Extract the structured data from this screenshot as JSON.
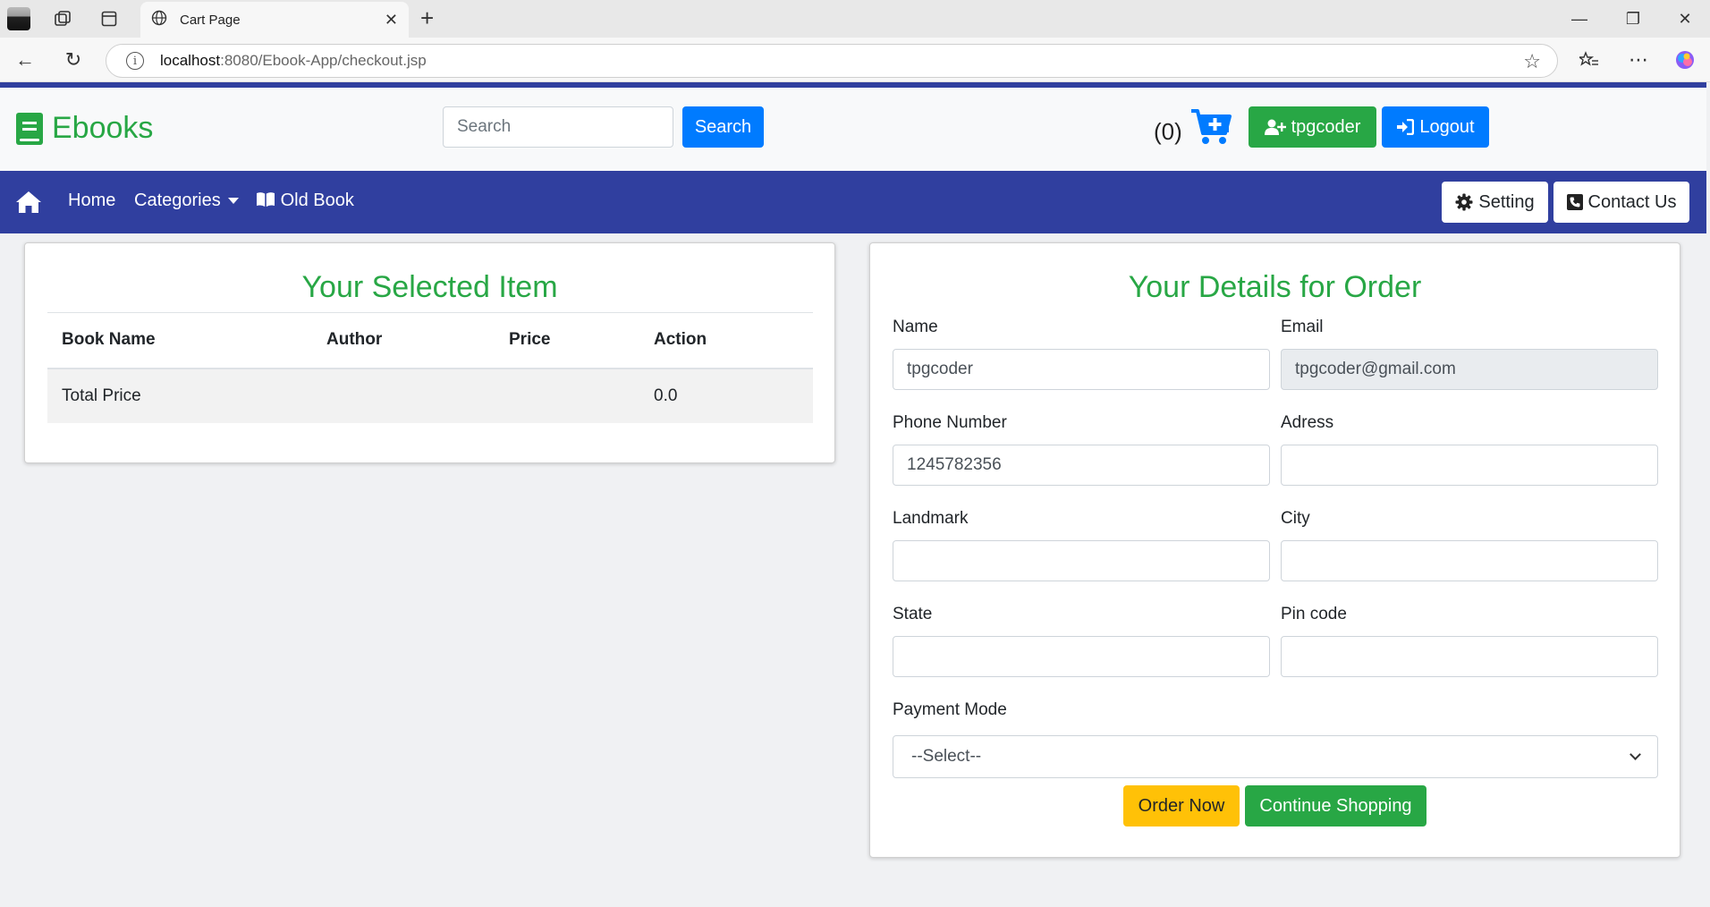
{
  "browser": {
    "tab_title": "Cart Page",
    "url_host": "localhost",
    "url_path": ":8080/Ebook-App/checkout.jsp"
  },
  "header": {
    "brand": "Ebooks",
    "search_placeholder": "Search",
    "search_button": "Search",
    "cart_count": "(0)",
    "user_button": "tpgcoder",
    "logout_button": "Logout"
  },
  "navbar": {
    "home": "Home",
    "categories": "Categories",
    "old_book": "Old Book",
    "setting": "Setting",
    "contact": "Contact Us"
  },
  "cart": {
    "title": "Your Selected Item",
    "columns": [
      "Book Name",
      "Author",
      "Price",
      "Action"
    ],
    "total_label": "Total Price",
    "total_value": "0.0"
  },
  "order_form": {
    "title": "Your Details for Order",
    "name_label": "Name",
    "name_value": "tpgcoder",
    "email_label": "Email",
    "email_value": "tpgcoder@gmail.com",
    "phone_label": "Phone Number",
    "phone_value": "1245782356",
    "address_label": "Adress",
    "address_value": "",
    "landmark_label": "Landmark",
    "landmark_value": "",
    "city_label": "City",
    "city_value": "",
    "state_label": "State",
    "state_value": "",
    "pincode_label": "Pin code",
    "pincode_value": "",
    "payment_label": "Payment Mode",
    "payment_selected": "--Select--",
    "order_button": "Order Now",
    "continue_button": "Continue Shopping"
  },
  "colors": {
    "brand_green": "#28a745",
    "navbar_blue": "#303f9f",
    "primary_blue": "#007bff",
    "warning_yellow": "#ffc107"
  }
}
